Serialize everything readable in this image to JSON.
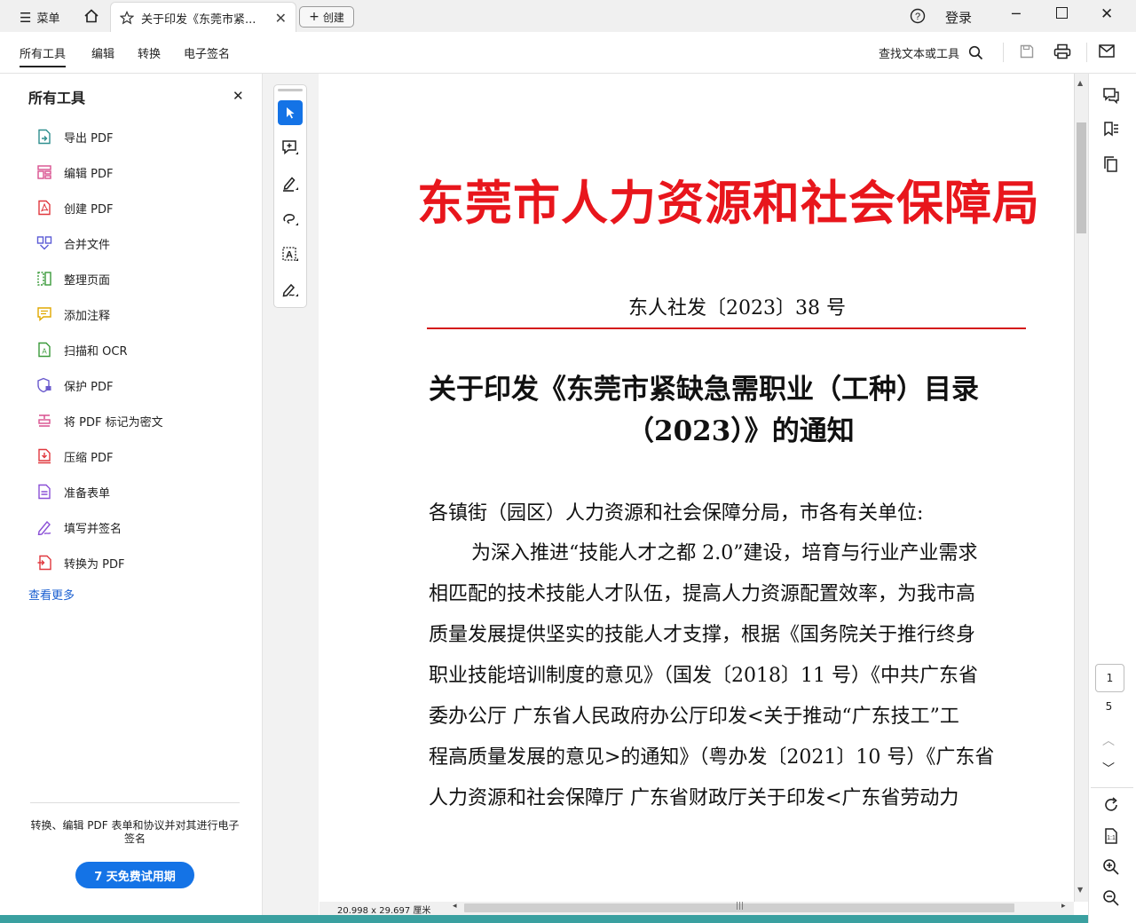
{
  "titlebar": {
    "menu_label": "菜单",
    "tab_title": "关于印发《东莞市紧...",
    "create_label": "创建",
    "login_label": "登录"
  },
  "toolbar": {
    "tabs": [
      "所有工具",
      "编辑",
      "转换",
      "电子签名"
    ],
    "search_label": "查找文本或工具"
  },
  "left_panel": {
    "title": "所有工具",
    "tools": [
      {
        "label": "导出 PDF",
        "icon": "export-pdf-icon",
        "color": "#2f8f8f"
      },
      {
        "label": "编辑 PDF",
        "icon": "edit-pdf-icon",
        "color": "#d9508f"
      },
      {
        "label": "创建 PDF",
        "icon": "create-pdf-icon",
        "color": "#e0383e"
      },
      {
        "label": "合并文件",
        "icon": "combine-files-icon",
        "color": "#5b5bd6"
      },
      {
        "label": "整理页面",
        "icon": "organize-pages-icon",
        "color": "#3a9a3a"
      },
      {
        "label": "添加注释",
        "icon": "comment-icon",
        "color": "#e0a800"
      },
      {
        "label": "扫描和 OCR",
        "icon": "scan-ocr-icon",
        "color": "#3a9a3a"
      },
      {
        "label": "保护 PDF",
        "icon": "protect-pdf-icon",
        "color": "#6a5acd"
      },
      {
        "label": "将 PDF 标记为密文",
        "icon": "redact-icon",
        "color": "#d9508f"
      },
      {
        "label": "压缩 PDF",
        "icon": "compress-pdf-icon",
        "color": "#e0383e"
      },
      {
        "label": "准备表单",
        "icon": "prepare-form-icon",
        "color": "#8a4fd6"
      },
      {
        "label": "填写并签名",
        "icon": "fill-sign-icon",
        "color": "#8a4fd6"
      },
      {
        "label": "转换为 PDF",
        "icon": "convert-pdf-icon",
        "color": "#e0383e"
      }
    ],
    "see_more": "查看更多",
    "promo_text": "转换、编辑 PDF 表单和协议并对其进行电子签名",
    "trial_button": "7 天免费试用期"
  },
  "document": {
    "agency_title": "东莞市人力资源和社会保障局",
    "doc_number": "东人社发〔2023〕38 号",
    "heading_line1": "关于印发《东莞市紧缺急需职业（工种）目录",
    "heading_line2": "（2023）》的通知",
    "body_lines": [
      "各镇街（园区）人力资源和社会保障分局，市各有关单位:",
      "为深入推进“技能人才之都 2.0”建设，培育与行业产业需求",
      "相匹配的技术技能人才队伍，提高人力资源配置效率，为我市高",
      "质量发展提供坚实的技能人才支撑，根据《国务院关于推行终身",
      "职业技能培训制度的意见》（国发〔2018〕11 号）《中共广东省",
      "委办公厅 广东省人民政府办公厅印发<关于推动“广东技工”工",
      "程高质量发展的意见>的通知》（粤办发〔2021〕10 号）《广东省",
      "人力资源和社会保障厅 广东省财政厅关于印发<广东省劳动力"
    ],
    "agency_color": "#e8161c",
    "rule_color": "#d41a1a"
  },
  "right_rail": {
    "current_page": "1",
    "total_pages": "5"
  },
  "status": {
    "page_size": "20.998 x 29.697 厘米"
  }
}
